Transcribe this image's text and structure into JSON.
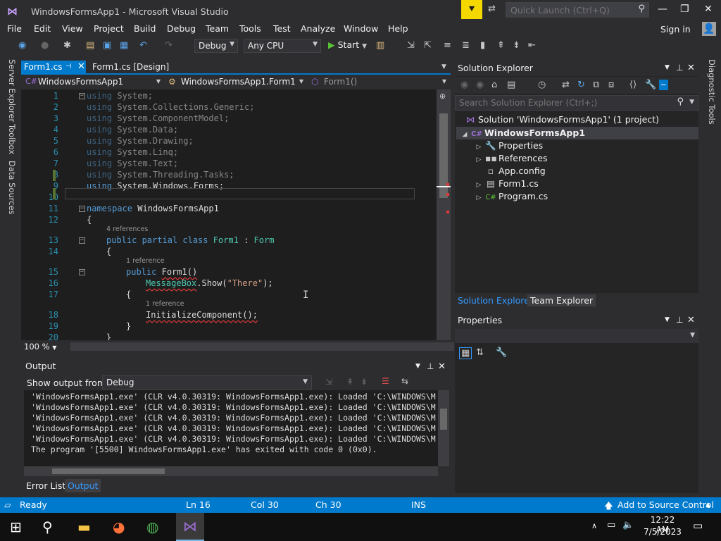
{
  "window": {
    "title": "WindowsFormsApp1 - Microsoft Visual Studio",
    "quick_launch_placeholder": "Quick Launch (Ctrl+Q)",
    "sign_in": "Sign in"
  },
  "menu": [
    "File",
    "Edit",
    "View",
    "Project",
    "Build",
    "Debug",
    "Team",
    "Tools",
    "Test",
    "Analyze",
    "Window",
    "Help"
  ],
  "toolbar": {
    "configuration": "Debug",
    "platform": "Any CPU",
    "start_label": "Start"
  },
  "left_tabs": [
    "Server Explorer",
    "Toolbox",
    "Data Sources"
  ],
  "right_tabs": [
    "Diagnostic Tools"
  ],
  "editor_tabs": [
    {
      "label": "Form1.cs",
      "active": true
    },
    {
      "label": "Form1.cs [Design]",
      "active": false
    }
  ],
  "navbar": {
    "project": "WindowsFormsApp1",
    "class": "WindowsFormsApp1.Form1",
    "member": "Form1()"
  },
  "code": {
    "line_numbers": [
      "1",
      "2",
      "3",
      "4",
      "5",
      "6",
      "7",
      "8",
      "9",
      "10",
      "11",
      "12",
      "13",
      "14",
      "15",
      "16",
      "17",
      "18",
      "19",
      "20"
    ],
    "using_kw": "using",
    "usings": [
      "System;",
      "System.Collections.Generic;",
      "System.ComponentModel;",
      "System.Data;",
      "System.Drawing;",
      "System.Linq;",
      "System.Text;",
      "System.Threading.Tasks;",
      "System.Windows.Forms;"
    ],
    "namespace_kw": "namespace",
    "namespace_name": "WindowsFormsApp1",
    "open_brace": "{",
    "close_brace": "}",
    "refs_class": "4 references",
    "class_mods": "public partial class",
    "class_name": "Form1",
    "class_colon": " : ",
    "class_base": "Form",
    "refs_ctor": "1 reference",
    "ctor_public": "public",
    "ctor_sig": "Form1()",
    "msgbox_type": "MessageBox",
    "msgbox_call": ".Show(",
    "msgbox_str": "\"There\"",
    "msgbox_end": ");",
    "refs_init": "1 reference",
    "init_call": "InitializeComponent();"
  },
  "zoom": "100 %",
  "output": {
    "title": "Output",
    "show_from_label": "Show output from:",
    "source": "Debug",
    "lines": [
      "'WindowsFormsApp1.exe' (CLR v4.0.30319: WindowsFormsApp1.exe): Loaded 'C:\\WINDOWS\\M",
      "'WindowsFormsApp1.exe' (CLR v4.0.30319: WindowsFormsApp1.exe): Loaded 'C:\\WINDOWS\\M",
      "'WindowsFormsApp1.exe' (CLR v4.0.30319: WindowsFormsApp1.exe): Loaded 'C:\\WINDOWS\\M",
      "'WindowsFormsApp1.exe' (CLR v4.0.30319: WindowsFormsApp1.exe): Loaded 'C:\\WINDOWS\\M",
      "'WindowsFormsApp1.exe' (CLR v4.0.30319: WindowsFormsApp1.exe): Loaded 'C:\\WINDOWS\\M",
      "The program '[5500] WindowsFormsApp1.exe' has exited with code 0 (0x0)."
    ]
  },
  "bottom_tabs": {
    "error_list": "Error List",
    "output": "Output"
  },
  "solution_explorer": {
    "title": "Solution Explorer",
    "search_placeholder": "Search Solution Explorer (Ctrl+;)",
    "solution": "Solution 'WindowsFormsApp1' (1 project)",
    "project": "WindowsFormsApp1",
    "items": [
      "Properties",
      "References",
      "App.config",
      "Form1.cs",
      "Program.cs"
    ],
    "tab_solution": "Solution Explorer",
    "tab_team": "Team Explorer"
  },
  "properties": {
    "title": "Properties"
  },
  "status": {
    "ready": "Ready",
    "ln": "Ln 16",
    "col": "Col 30",
    "ch": "Ch 30",
    "ins": "INS",
    "source_control": "Add to Source Control"
  },
  "clock": {
    "time": "12:22 AM",
    "date": "7/5/2023"
  },
  "colors": {
    "accent": "#007acc",
    "background": "#2d2d30",
    "editor": "#1e1e1e"
  }
}
